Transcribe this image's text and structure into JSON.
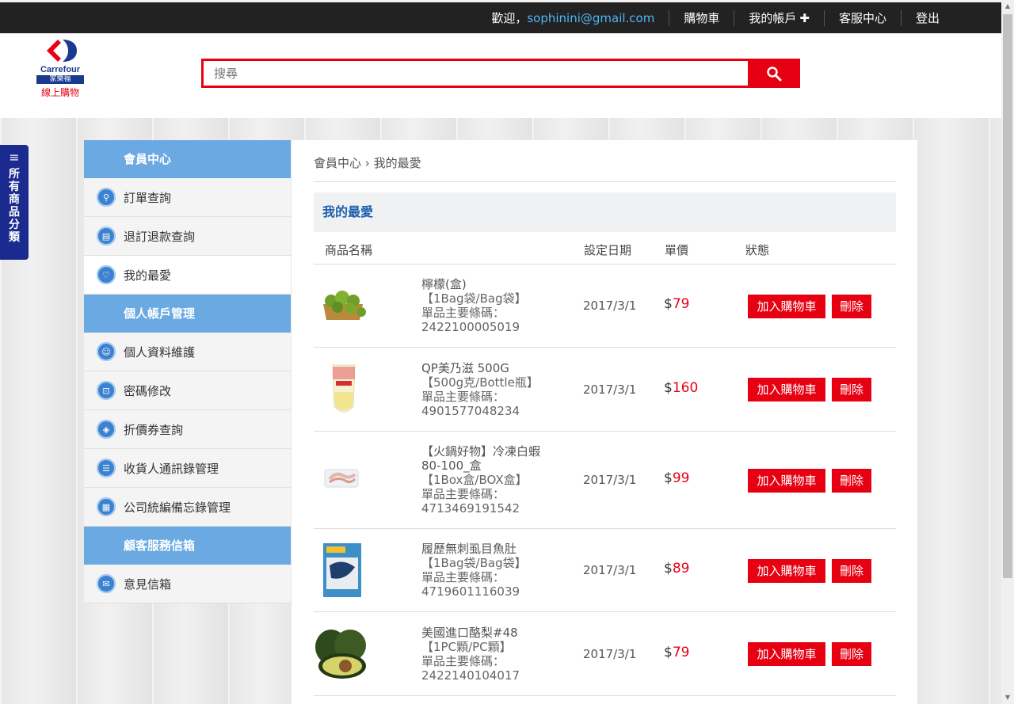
{
  "topbar": {
    "welcome": "歡迎，",
    "email": "sophinini@gmail.com",
    "cart": "購物車",
    "account": "我的帳戶",
    "account_plus": "✚",
    "service": "客服中心",
    "logout": "登出"
  },
  "logo": {
    "brand": "Carrefour",
    "cn": "家樂福",
    "sub": "線上購物"
  },
  "search": {
    "placeholder": "搜尋"
  },
  "sidetab": {
    "label": "所有商品分類"
  },
  "sidebar": {
    "groups": [
      {
        "title": "會員中心",
        "items": [
          "訂單查詢",
          "退訂退款查詢",
          "我的最愛"
        ]
      },
      {
        "title": "個人帳戶管理",
        "items": [
          "個人資料維護",
          "密碼修改",
          "折價券查詢",
          "收貨人通訊錄管理",
          "公司統編備忘錄管理"
        ]
      },
      {
        "title": "顧客服務信箱",
        "items": [
          "意見信箱"
        ]
      }
    ]
  },
  "breadcrumb": {
    "root": "會員中心",
    "sep": "›",
    "current": "我的最愛"
  },
  "panel": {
    "title": "我的最愛"
  },
  "table": {
    "headers": {
      "name": "商品名稱",
      "date": "設定日期",
      "price": "單價",
      "status": "狀態"
    },
    "add_label": "加入購物車",
    "delete_label": "刪除",
    "currency": "$",
    "rows": [
      {
        "name": "檸檬(盒)",
        "spec": "【1Bag袋/Bag袋】",
        "code_label": "單品主要條碼：",
        "code": "2422100005019",
        "date": "2017/3/1",
        "price": "79"
      },
      {
        "name": "QP美乃滋 500G",
        "spec": "【500g克/Bottle瓶】",
        "code_label": "單品主要條碼：",
        "code": "4901577048234",
        "date": "2017/3/1",
        "price": "160"
      },
      {
        "name": "【火鍋好物】冷凍白蝦80-100_盒",
        "spec": "【1Box盒/BOX盒】",
        "code_label": "單品主要條碼：",
        "code": "4713469191542",
        "date": "2017/3/1",
        "price": "99"
      },
      {
        "name": "履歷無刺虱目魚肚",
        "spec": "【1Bag袋/Bag袋】",
        "code_label": "單品主要條碼：",
        "code": "4719601116039",
        "date": "2017/3/1",
        "price": "89"
      },
      {
        "name": "美國進口酪梨#48",
        "spec": "【1PC顆/PC顆】",
        "code_label": "單品主要條碼：",
        "code": "2422140104017",
        "date": "2017/3/1",
        "price": "79"
      }
    ]
  },
  "colors": {
    "brand_red": "#e60012",
    "sidebar_head": "#6aa9e2",
    "link_blue": "#4fb6f2",
    "navy": "#1a2a8f"
  }
}
